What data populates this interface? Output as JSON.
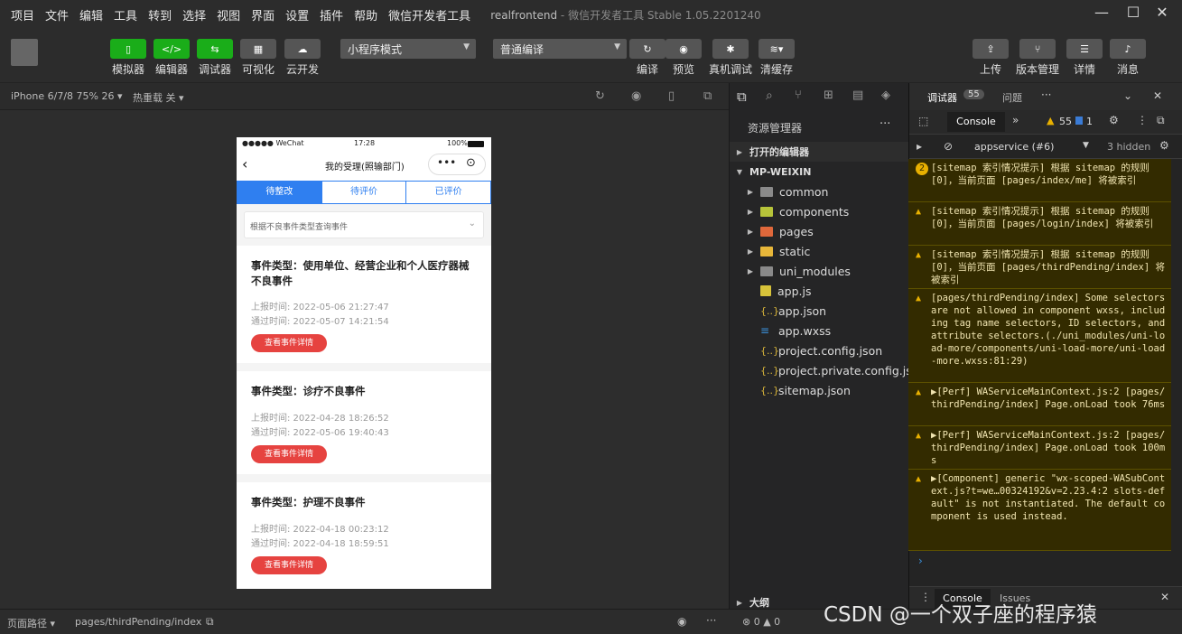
{
  "menu": [
    "项目",
    "文件",
    "编辑",
    "工具",
    "转到",
    "选择",
    "视图",
    "界面",
    "设置",
    "插件",
    "帮助",
    "微信开发者工具"
  ],
  "window": {
    "title": "realfrontend",
    "subtitle": "- 微信开发者工具 Stable 1.05.2201240"
  },
  "toolbar": {
    "simulator": "模拟器",
    "editor": "编辑器",
    "debugger": "调试器",
    "visual": "可视化",
    "cloud": "云开发",
    "mode": "小程序模式",
    "compile_mode": "普通编译",
    "compile": "编译",
    "preview": "预览",
    "real_debug": "真机调试",
    "clear_cache": "清缓存",
    "upload": "上传",
    "version": "版本管理",
    "details": "详情",
    "messages": "消息"
  },
  "simbar": {
    "device": "iPhone 6/7/8 75% 26",
    "hotreload": "热重载 关"
  },
  "phone": {
    "status_left": "●●●●● WeChat",
    "status_time": "17:28",
    "status_battery": "100%",
    "nav_title": "我的受理(照输部门)",
    "tabs": [
      "待整改",
      "待评价",
      "已评价"
    ],
    "filter_placeholder": "根据不良事件类型查询事件",
    "cards": [
      {
        "title": "事件类型：使用单位、经营企业和个人医疗器械不良事件",
        "report": "上报时间: 2022-05-06 21:27:47",
        "pass": "通过时间: 2022-05-07 14:21:54",
        "button": "查看事件详情"
      },
      {
        "title": "事件类型：诊疗不良事件",
        "report": "上报时间: 2022-04-28 18:26:52",
        "pass": "通过时间: 2022-05-06 19:40:43",
        "button": "查看事件详情"
      },
      {
        "title": "事件类型：护理不良事件",
        "report": "上报时间: 2022-04-18 00:23:12",
        "pass": "通过时间: 2022-04-18 18:59:51",
        "button": "查看事件详情"
      }
    ]
  },
  "explorer": {
    "title": "资源管理器",
    "open_editors": "打开的编辑器",
    "project": "MP-WEIXIN",
    "folders": [
      "common",
      "components",
      "pages",
      "static",
      "uni_modules"
    ],
    "files": [
      "app.js",
      "app.json",
      "app.wxss",
      "project.config.json",
      "project.private.config.js...",
      "sitemap.json"
    ],
    "outline": "大纲",
    "errors": "0",
    "warnings": "0"
  },
  "devtools": {
    "tab_debugger": "调试器",
    "count": "55",
    "tab_issues": "问题",
    "console_tab": "Console",
    "warn_count": "55",
    "info_count": "1",
    "context": "appservice (#6)",
    "hidden": "3 hidden",
    "messages": [
      {
        "text": "[sitemap 索引情况提示] 根据 sitemap 的规则[0]，当前页面 [pages/index/me] 将被索引",
        "badge": "2"
      },
      {
        "text": "[sitemap 索引情况提示] 根据 sitemap 的规则[0]，当前页面 [pages/login/index] 将被索引"
      },
      {
        "text": "[sitemap 索引情况提示] 根据 sitemap 的规则[0]，当前页面 [pages/thirdPending/index] 将被索引"
      },
      {
        "text": "[pages/thirdPending/index] Some selectors are not allowed in component wxss, including tag name selectors, ID selectors, and attribute selectors.(./uni_modules/uni-load-more/components/uni-load-more/uni-load-more.wxss:81:29)"
      },
      {
        "text": "▶[Perf]   WAServiceMainContext.js:2 [pages/thirdPending/index] Page.onLoad took 76ms"
      },
      {
        "text": "▶[Perf]   WAServiceMainContext.js:2 [pages/thirdPending/index] Page.onLoad took 100ms"
      },
      {
        "text": "▶[Component] generic \"wx-scoped-WASubContext.js?t=we…00324192&v=2.23.4:2 slots-default\" is not instantiated. The default component is used instead."
      }
    ],
    "bottom_console": "Console",
    "bottom_issues": "Issues"
  },
  "bottombar": {
    "path_label": "页面路径",
    "path": "pages/thirdPending/index",
    "watermark": "CSDN @一个双子座的程序猿"
  }
}
